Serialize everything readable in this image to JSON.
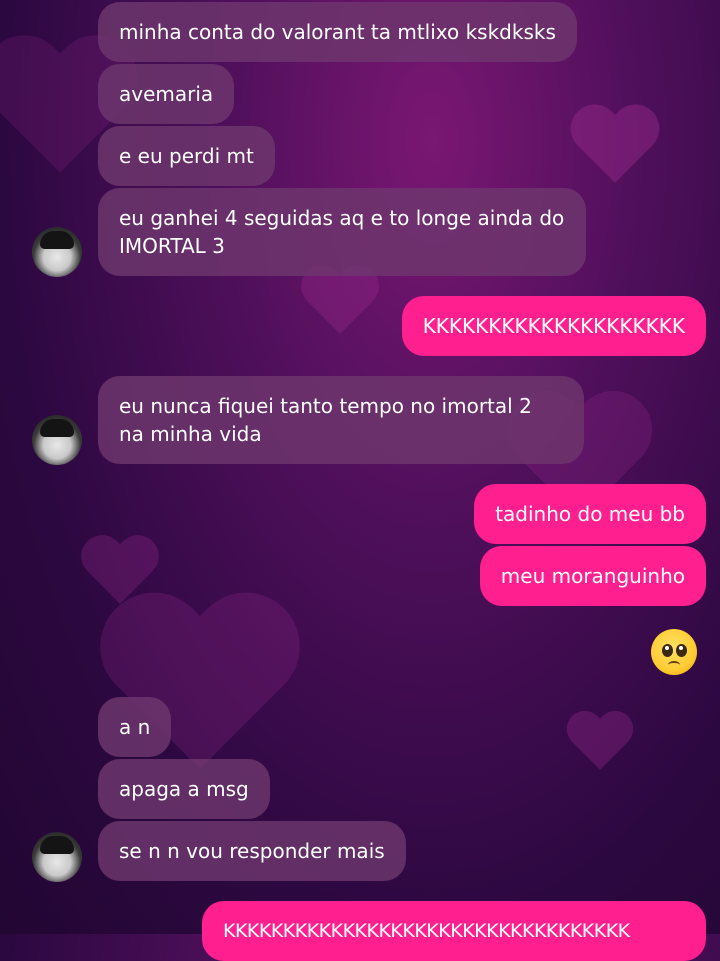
{
  "messages": [
    {
      "text": "minha conta do valorant ta mtlixo kskdksks"
    },
    {
      "text": "avemaria"
    },
    {
      "text": "e eu perdi mt"
    },
    {
      "text": "eu ganhei 4 seguidas aq e to longe ainda do IMORTAL 3"
    },
    {
      "text": "KKKKKKKKKKKKKKKKKKKK"
    },
    {
      "text": "eu nunca fiquei tanto tempo no imortal 2 na minha vida"
    },
    {
      "text": "tadinho do meu bb"
    },
    {
      "text": "meu moranguinho"
    },
    {
      "text": "a n"
    },
    {
      "text": "apaga a msg"
    },
    {
      "text": "se n n vou responder mais"
    },
    {
      "text": "KKKKKKKKKKKKKKKKKKKKKKKKKKKKKKKKKK"
    }
  ],
  "emoji": {
    "name": "pleading-face-emoji"
  },
  "colors": {
    "incoming_bubble": "#6e376e",
    "outgoing_bubble": "#ff1f8e",
    "text": "#ffffff"
  }
}
